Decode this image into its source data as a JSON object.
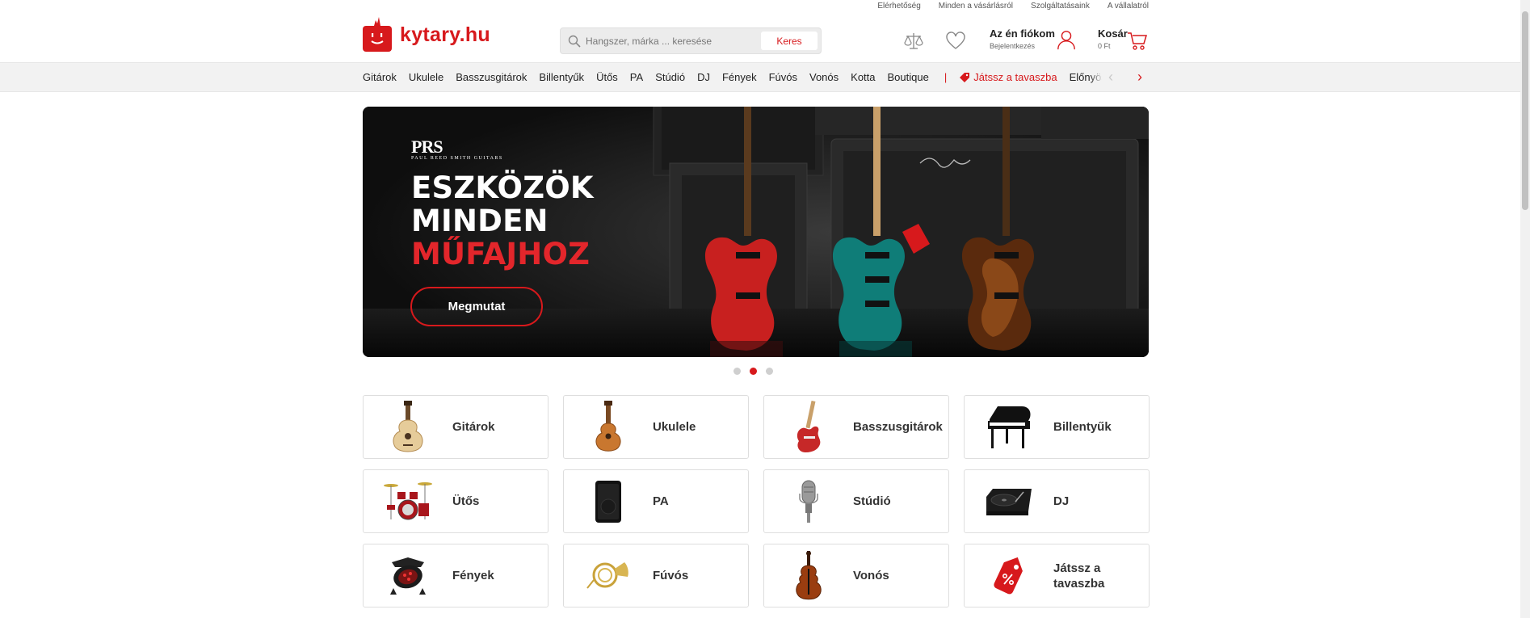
{
  "utility_links": [
    "Elérhetőség",
    "Minden a vásárlásról",
    "Szolgáltatásaink",
    "A vállalatról"
  ],
  "logo": {
    "text": "kytary.hu",
    "brand_color": "#d7191c"
  },
  "search": {
    "placeholder": "Hangszer, márka ... keresése",
    "button": "Keres"
  },
  "header": {
    "compare_icon": "scale-icon",
    "wishlist_icon": "heart-icon",
    "account": {
      "title": "Az én fiókom",
      "subtitle": "Bejelentkezés",
      "icon": "user-icon"
    },
    "cart": {
      "title": "Kosár",
      "subtitle": "0 Ft",
      "icon": "cart-icon"
    }
  },
  "nav": {
    "items": [
      "Gitárok",
      "Ukulele",
      "Basszusgitárok",
      "Billentyűk",
      "Ütős",
      "PA",
      "Stúdió",
      "DJ",
      "Fények",
      "Fúvós",
      "Vonós",
      "Kotta",
      "Boutique"
    ],
    "separator": "|",
    "promo": "Játssz a tavaszba",
    "extra": "Előnyös kész",
    "prev_arrow": "‹",
    "next_arrow": "›"
  },
  "hero": {
    "brand": "PRS",
    "brand_sub": "PAUL REED SMITH GUITARS",
    "headline_1": "ESZKÖZÖK",
    "headline_2": "MINDEN",
    "headline_3": "MŰFAJHOZ",
    "cta": "Megmutat",
    "slides": 3,
    "active_slide": 2
  },
  "categories": [
    {
      "label": "Gitárok",
      "icon": "acoustic-guitar-icon"
    },
    {
      "label": "Ukulele",
      "icon": "ukulele-icon"
    },
    {
      "label": "Basszusgitárok",
      "icon": "bass-guitar-icon"
    },
    {
      "label": "Billentyűk",
      "icon": "piano-icon"
    },
    {
      "label": "Ütős",
      "icon": "drum-kit-icon"
    },
    {
      "label": "PA",
      "icon": "speaker-icon"
    },
    {
      "label": "Stúdió",
      "icon": "microphone-icon"
    },
    {
      "label": "DJ",
      "icon": "turntable-icon"
    },
    {
      "label": "Fények",
      "icon": "stage-light-icon"
    },
    {
      "label": "Fúvós",
      "icon": "french-horn-icon"
    },
    {
      "label": "Vonós",
      "icon": "violin-icon"
    },
    {
      "label": "Játssz a tavaszba",
      "icon": "discount-tag-icon"
    }
  ]
}
